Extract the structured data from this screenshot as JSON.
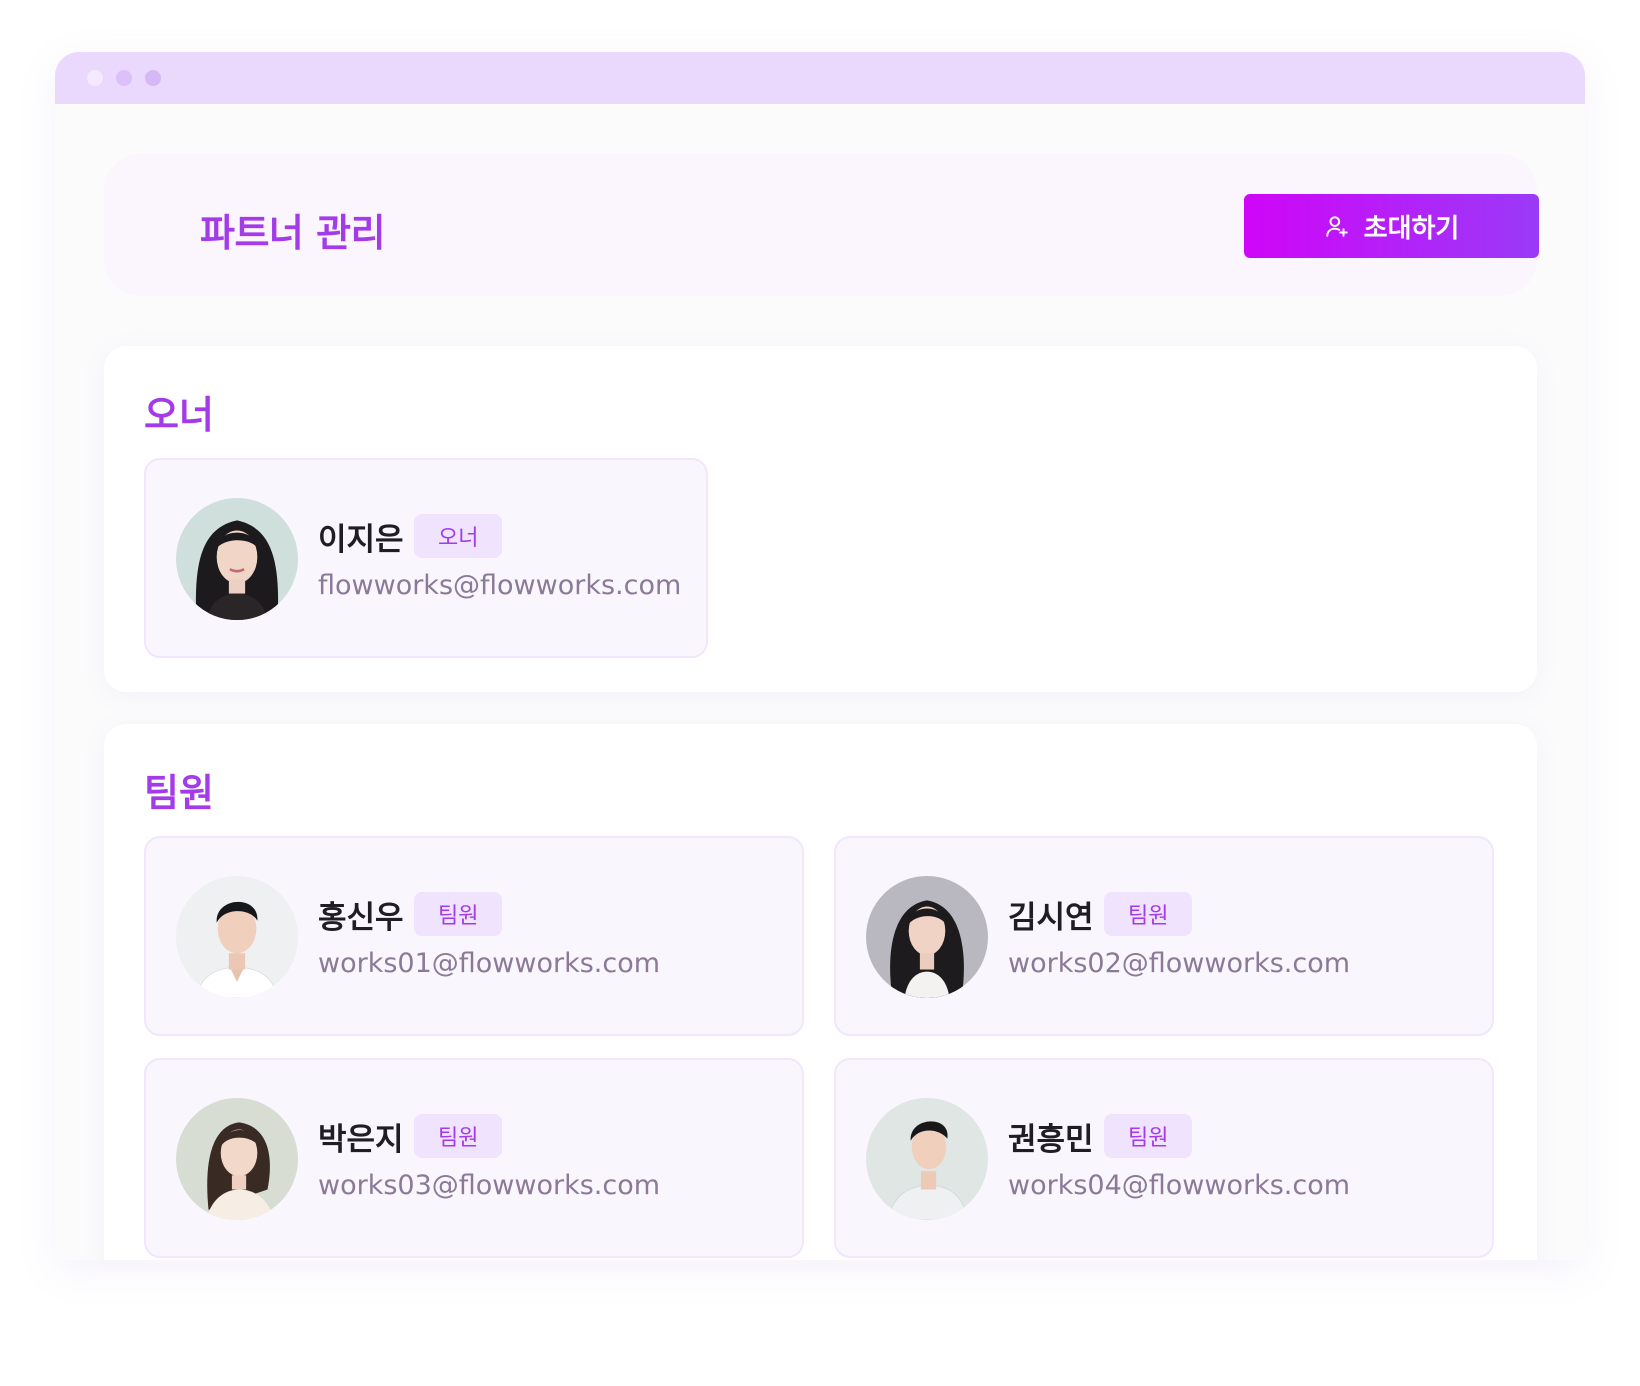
{
  "window": {
    "dots": [
      "#f4e9ff",
      "#dbc0f9",
      "#d6b8f6"
    ]
  },
  "header": {
    "title": "파트너 관리",
    "invite_label": "초대하기",
    "invite_icon": "user-plus-icon"
  },
  "owner_section": {
    "title": "오너",
    "members": [
      {
        "name": "이지은",
        "role": "오너",
        "email": "flowworks@flowworks.com",
        "avatar": "avatar-woman-long-dark-hair"
      }
    ]
  },
  "member_section": {
    "title": "팀원",
    "members": [
      {
        "name": "홍신우",
        "role": "팀원",
        "email": "works01@flowworks.com",
        "avatar": "avatar-man-white-shirt"
      },
      {
        "name": "김시연",
        "role": "팀원",
        "email": "works02@flowworks.com",
        "avatar": "avatar-woman-wavy-hair"
      },
      {
        "name": "박은지",
        "role": "팀원",
        "email": "works03@flowworks.com",
        "avatar": "avatar-woman-ponytail"
      },
      {
        "name": "권흥민",
        "role": "팀원",
        "email": "works04@flowworks.com",
        "avatar": "avatar-man-side-profile"
      }
    ]
  },
  "colors": {
    "accent": "#a43be8",
    "button_gradient_start": "#d005f8",
    "button_gradient_end": "#9a3af7",
    "badge_bg": "#efe3fd",
    "email": "#8a7a98"
  }
}
